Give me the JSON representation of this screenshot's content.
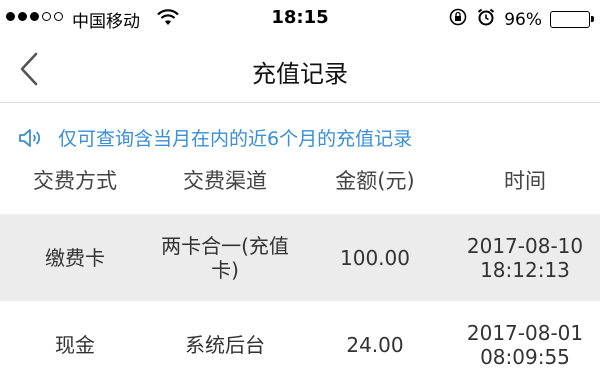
{
  "status_bar": {
    "carrier": "中国移动",
    "time": "18:15",
    "battery_percent": "96%",
    "battery_level": 0.96
  },
  "nav": {
    "title": "充值记录",
    "back_icon": "chevron-left-icon"
  },
  "notice": {
    "icon": "speaker-icon",
    "text": "仅可查询含当月在内的近6个月的充值记录",
    "color": "#3a8fd6"
  },
  "table": {
    "headers": [
      "交费方式",
      "交费渠道",
      "金额(元)",
      "时间"
    ],
    "rows": [
      {
        "method": "缴费卡",
        "channel": "两卡合一(充值卡)",
        "amount": "100.00",
        "date": "2017-08-10",
        "time": "18:12:13"
      },
      {
        "method": "现金",
        "channel": "系统后台",
        "amount": "24.00",
        "date": "2017-08-01",
        "time": "08:09:55"
      }
    ]
  }
}
